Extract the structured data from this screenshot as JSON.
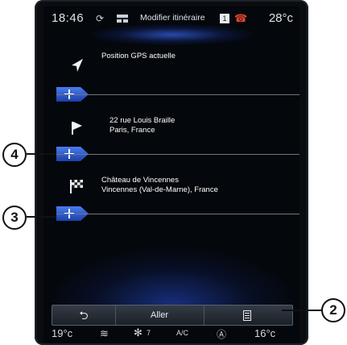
{
  "status_bar": {
    "time": "18:46",
    "title": "Modifier itinéraire",
    "outside_temp": "28°c",
    "badge": "1"
  },
  "route": {
    "steps": [
      {
        "icon": "arrow-gps-icon",
        "line1": "Position GPS actuelle",
        "line2": ""
      },
      {
        "icon": "flag-icon",
        "line1": "22 rue Louis Braille",
        "line2": "Paris, France"
      },
      {
        "icon": "checkered-flag-icon",
        "line1": "Château de Vincennes",
        "line2": "Vincennes (Val-de-Marne), France"
      }
    ]
  },
  "bottom_bar": {
    "back_label": "",
    "go_label": "Aller",
    "list_label": ""
  },
  "climate": {
    "left_temp": "19°c",
    "fan_level": "7",
    "ac_label": "A/C",
    "right_temp": "16°c"
  },
  "callouts": [
    "4",
    "3",
    "2"
  ],
  "colors": {
    "accent_blue": "#2a5ce6",
    "screen_bg": "#04070b"
  }
}
